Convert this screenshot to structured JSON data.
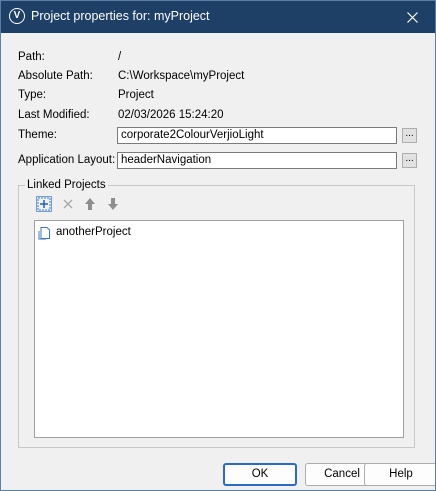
{
  "titlebar": {
    "title": "Project properties for: myProject",
    "app_icon_letter": "V",
    "close_glyph": "✕"
  },
  "properties": {
    "path_label": "Path:",
    "path_value": "/",
    "abs_path_label": "Absolute Path:",
    "abs_path_value": "C:\\Workspace\\myProject",
    "type_label": "Type:",
    "type_value": "Project",
    "modified_label": "Last Modified:",
    "modified_value": "02/03/2026 15:24:20",
    "theme_label": "Theme:",
    "theme_value": "corporate2ColourVerjioLight",
    "layout_label": "Application Layout:",
    "layout_value": "headerNavigation",
    "browse_label": "..."
  },
  "linked": {
    "group_label": "Linked Projects",
    "toolbar": [
      "add-icon",
      "remove-icon",
      "move-up-icon",
      "move-down-icon"
    ],
    "items": [
      {
        "label": "anotherProject",
        "icon": "project-icon"
      }
    ]
  },
  "buttons": {
    "ok": "OK",
    "cancel": "Cancel",
    "help": "Help"
  },
  "colors": {
    "titlebar": "#1e3f66",
    "accent": "#2b6bc4",
    "dialog_bg": "#f0f0f0"
  }
}
